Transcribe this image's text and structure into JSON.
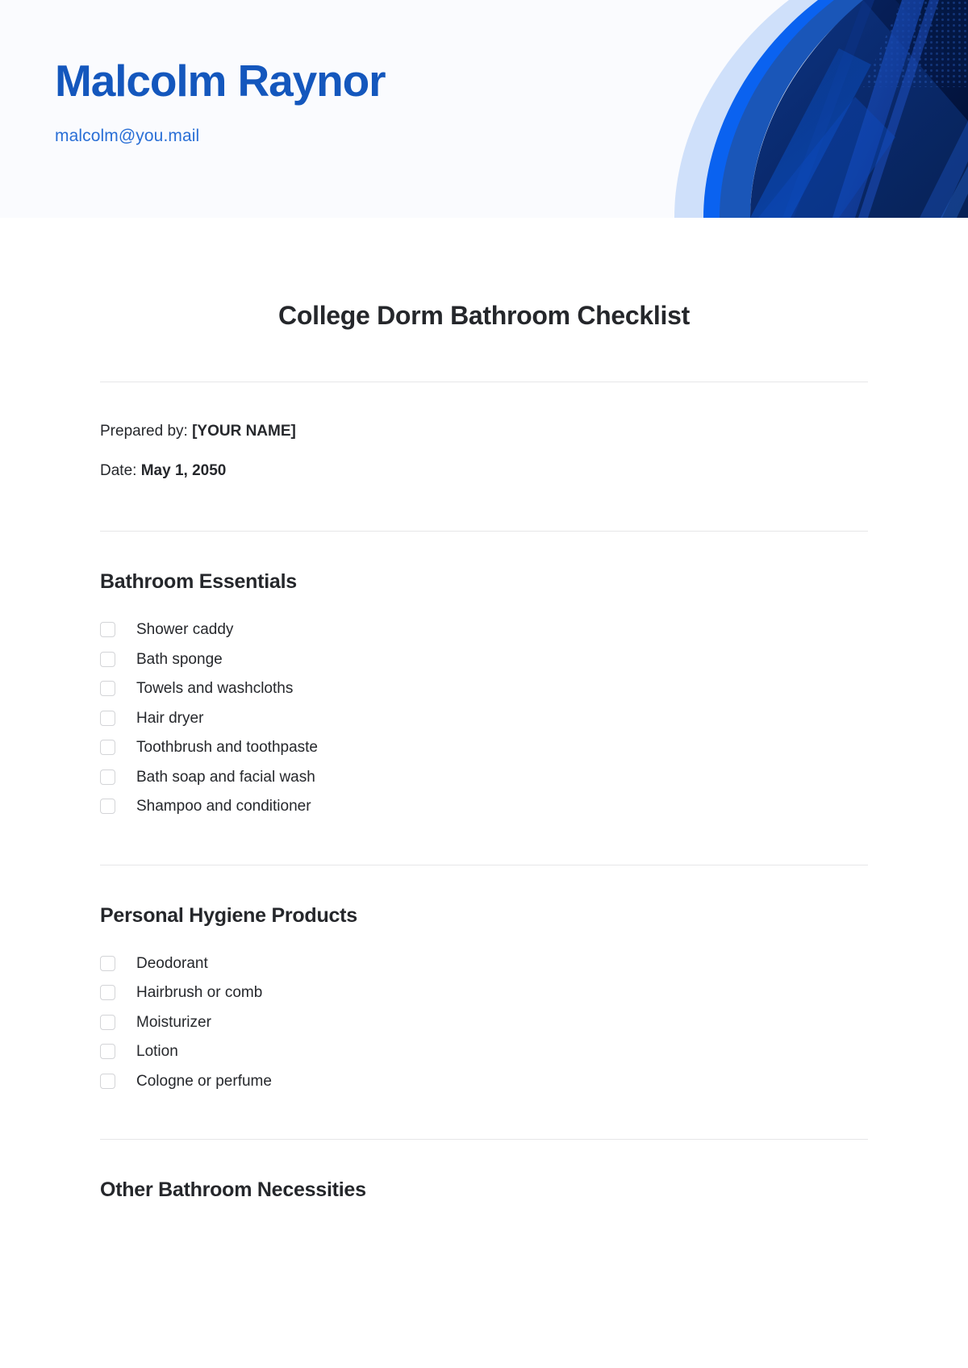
{
  "header": {
    "brand_name": "Malcolm Raynor",
    "email": "malcolm@you.mail",
    "colors": {
      "brand_blue": "#1457bd",
      "email_blue": "#2a6fd6",
      "banner_bg": "#fafbfe",
      "band_light": "#cfe0fa",
      "band_bright": "#0a62f0",
      "band_medium": "#1a56b8",
      "band_dark": "#0a2a6e",
      "band_darkest": "#041743"
    }
  },
  "document": {
    "title": "College Dorm Bathroom Checklist",
    "meta": [
      {
        "label": "Prepared by:",
        "value": "[YOUR NAME]"
      },
      {
        "label": "Date:",
        "value": "May 1, 2050"
      }
    ],
    "sections": [
      {
        "heading": "Bathroom Essentials",
        "items": [
          "Shower caddy",
          "Bath sponge",
          "Towels and washcloths",
          "Hair dryer",
          "Toothbrush and toothpaste",
          "Bath soap and facial wash",
          "Shampoo and conditioner"
        ]
      },
      {
        "heading": "Personal Hygiene Products",
        "items": [
          "Deodorant",
          "Hairbrush or comb",
          "Moisturizer",
          "Lotion",
          "Cologne or perfume"
        ]
      },
      {
        "heading": "Other Bathroom Necessities",
        "items": []
      }
    ]
  }
}
